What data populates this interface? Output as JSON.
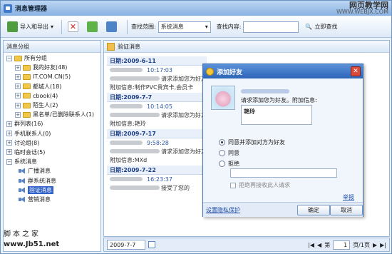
{
  "window": {
    "title": "消息管理器"
  },
  "watermark": {
    "line1": "网页教学网",
    "line2": "WWW.WEBJX.COM"
  },
  "toolbar": {
    "import_export": "导入和导出",
    "scope_label": "查找范围:",
    "scope_value": "系统消息",
    "content_label": "查找内容:",
    "content_value": "",
    "search_now": "立即查找"
  },
  "tree": {
    "header": "消息分组",
    "nodes": [
      {
        "label": "所有分组",
        "level": 0,
        "toggle": "−",
        "icon": "folder-icon"
      },
      {
        "label": "我的好友(48)",
        "level": 1,
        "toggle": "+",
        "icon": "folder-icon"
      },
      {
        "label": "IT.COM.CN(5)",
        "level": 1,
        "toggle": "+",
        "icon": "folder-icon"
      },
      {
        "label": "都城人(18)",
        "level": 1,
        "toggle": "+",
        "icon": "folder-icon"
      },
      {
        "label": "cbook(4)",
        "level": 1,
        "toggle": "+",
        "icon": "folder-icon"
      },
      {
        "label": "陌生人(2)",
        "level": 1,
        "toggle": "+",
        "icon": "folder-icon"
      },
      {
        "label": "黑名单/已删除联系人(1)",
        "level": 1,
        "toggle": "+",
        "icon": "folder-icon"
      },
      {
        "label": "群列表(16)",
        "level": 0,
        "toggle": "+",
        "icon": ""
      },
      {
        "label": "手机联系人(0)",
        "level": 0,
        "toggle": "+",
        "icon": ""
      },
      {
        "label": "讨论组(8)",
        "level": 0,
        "toggle": "+",
        "icon": ""
      },
      {
        "label": "临时会话(5)",
        "level": 0,
        "toggle": "+",
        "icon": ""
      },
      {
        "label": "系统消息",
        "level": 0,
        "toggle": "−",
        "icon": ""
      },
      {
        "label": "广播消息",
        "level": 1,
        "toggle": "",
        "icon": "speaker-icon"
      },
      {
        "label": "群系统消息",
        "level": 1,
        "toggle": "",
        "icon": "speaker-icon"
      },
      {
        "label": "验证消息",
        "level": 1,
        "toggle": "",
        "icon": "speaker-icon",
        "selected": true
      },
      {
        "label": "营销消息",
        "level": 1,
        "toggle": "",
        "icon": "speaker-icon"
      }
    ]
  },
  "main": {
    "header": "验证消息",
    "groups": [
      {
        "date": "日期:2009-6-11",
        "time": "10:17:03",
        "line1": "请求添加您为好友",
        "line2": "附加信息:制作PVC贵宾卡,会员卡"
      },
      {
        "date": "日期:2009-7-7",
        "time": "10:14:05",
        "line1": "请求添加您为好友",
        "line2": "附加信息:艳玲"
      },
      {
        "date": "日期:2009-7-17",
        "time": "9:58:28",
        "line1": "请求添加您为好友",
        "line2": "附加信息:MXd"
      },
      {
        "date": "日期:2009-7-22",
        "time": "16:23:37",
        "line1": "接受了您的",
        "line2": ""
      }
    ]
  },
  "bottom": {
    "date": "2009-7-7",
    "page_prefix": "第",
    "page": "1",
    "page_suffix": "页/1页"
  },
  "footer": {
    "cn": "脚本之家",
    "url": "www.Jb51.net"
  },
  "dialog": {
    "title": "添加好友",
    "request_text": "请求添加您为好友。附加信息:",
    "message": "艳玲",
    "options": [
      "同意并添加对方为好友",
      "同意",
      "拒绝"
    ],
    "selected_option": 0,
    "reject_placeholder": "",
    "checkbox": "拒绝再接收此人请求",
    "report": "举报",
    "privacy_link": "设置隐私保护",
    "ok": "确定",
    "cancel": "取消"
  }
}
